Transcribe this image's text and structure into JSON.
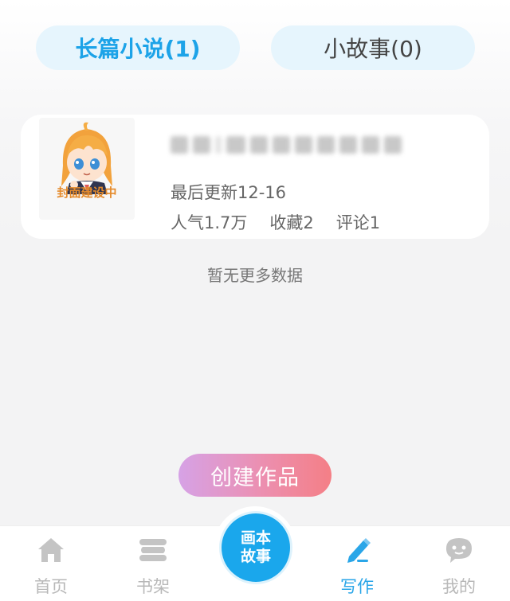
{
  "tabs": {
    "long_novel": "长篇小说(1)",
    "short_story": "小故事(0)"
  },
  "work": {
    "cover_caption": "封面建设中",
    "last_update": "最后更新12-16",
    "popularity": "人气1.7万",
    "favorites": "收藏2",
    "comments": "评论1"
  },
  "list_end_text": "暂无更多数据",
  "create_button": "创建作品",
  "nav": {
    "home": "首页",
    "bookshelf": "书架",
    "center_line1": "画本",
    "center_line2": "故事",
    "write": "写作",
    "mine": "我的"
  },
  "colors": {
    "accent": "#1ca3e8",
    "tab_bg": "#e6f5fd",
    "create_gradient_start": "#d6a2e6",
    "create_gradient_end": "#f47f86"
  }
}
